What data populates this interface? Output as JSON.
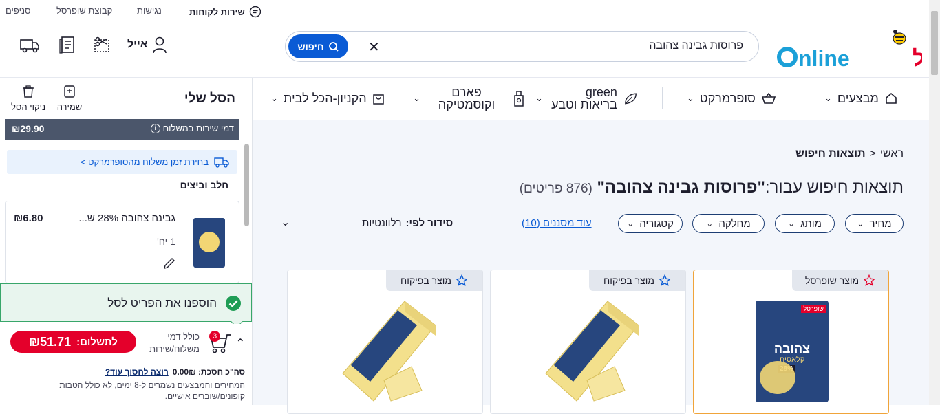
{
  "topbar": {
    "customer_service": "שירות לקוחות",
    "accessibility": "נגישות",
    "group": "קבוצת שופרסל",
    "branches": "סניפים"
  },
  "header": {
    "logo_text": "שופרסל",
    "logo_online": "Online",
    "search_value": "פרוסות גבינה צהובה",
    "search_button": "חיפוש",
    "user_name": "אייל"
  },
  "nav": {
    "items": [
      {
        "label": "מבצעים"
      },
      {
        "label": "סופרמרקט"
      },
      {
        "label": "green בריאות וטבע"
      },
      {
        "label": "פארם וקוסמטיקה"
      },
      {
        "label": "הקניון-הכל לבית"
      }
    ]
  },
  "cart": {
    "title": "הסל שלי",
    "save_label": "שמירה",
    "clear_label": "ניקוי הסל",
    "delivery_fee_label": "דמי שירות במשלוח",
    "delivery_fee": "₪29.90",
    "delivery_time_link": "בחירת זמן משלוח מהסופרמרקט >",
    "category": "חלב וביצים",
    "item": {
      "name": "גבינה צהובה 28% ש...",
      "price": "₪6.80",
      "qty": "1 יח'"
    },
    "added_msg": "הוספנו את הפריט לסל",
    "count": "3",
    "incl_fees": "כולל דמי משלוח/שירות",
    "pay_label": "לתשלום:",
    "pay_amount": "₪51.71",
    "savings_label": "סה\"כ חסכת: 0.00₪",
    "savings_link": "רוצה לחסוך עוד?",
    "disclaimer": "המחירים והמבצעים נשמרים ל-8 ימים, לא כולל הטבות קופונים/שוברים אישיים."
  },
  "main": {
    "breadcrumb_home": "ראשי",
    "breadcrumb_current": "תוצאות חיפוש",
    "results_prefix": "תוצאות חיפוש עבור:",
    "results_query": "\"פרוסות גבינה צהובה\"",
    "results_count": "(876 פריטים)",
    "filters": [
      "מחיר",
      "מותג",
      "מחלקה",
      "קטגוריה"
    ],
    "more_filters": "עוד מסננים (10)",
    "sort_label": "סידור לפי:",
    "sort_value": "רלוונטיות",
    "cards": [
      {
        "tag": "מוצר שופרסל"
      },
      {
        "tag": "מוצר בפיקוח"
      },
      {
        "tag": "מוצר בפיקוח"
      }
    ],
    "package_brand": "שופרסל",
    "package_name": "צהובה",
    "package_sub": "קלאסית",
    "package_pct": "28%"
  }
}
